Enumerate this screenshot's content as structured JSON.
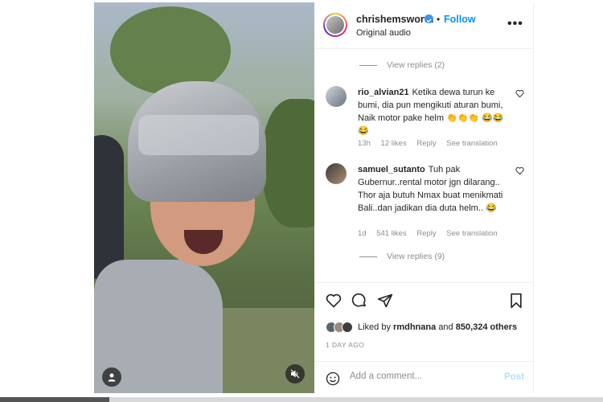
{
  "header": {
    "username": "chrishemsworth",
    "separator": "•",
    "follow_label": "Follow",
    "audio": "Original audio",
    "more_label": "•••"
  },
  "comments": {
    "view_replies_top": "View replies (2)",
    "items": [
      {
        "user": "rio_alvian21",
        "text": "Ketika dewa turun ke bumi, dia pun mengikuti aturan bumi, Naik motor pake helm 👏👏👏 😂😂😂",
        "time": "13h",
        "likes": "12 likes",
        "reply": "Reply",
        "translate": "See translation"
      },
      {
        "user": "samuel_sutanto",
        "text": "Tuh pak Gubernur..rental motor jgn dilarang.. Thor aja butuh Nmax buat menikmati Bali..dan jadikan dia duta helm.. 😂",
        "time": "1d",
        "likes": "541 likes",
        "reply": "Reply",
        "translate": "See translation"
      }
    ],
    "view_replies_bottom": "View replies (9)"
  },
  "actions": {
    "liked_by_prefix": "Liked by",
    "liked_by_user": "rmdhnana",
    "and_text": "and",
    "likes_count": "850,324 others",
    "time_ago": "1 DAY AGO"
  },
  "add_comment": {
    "placeholder": "Add a comment...",
    "post_label": "Post"
  },
  "icons": {
    "verified": "verified-badge-icon",
    "like": "heart-icon",
    "comment": "comment-icon",
    "share": "share-icon",
    "save": "bookmark-icon",
    "emoji": "smiley-icon",
    "tag": "user-tag-icon",
    "mute": "muted-speaker-icon"
  },
  "colors": {
    "accent": "#0095f6",
    "verified": "#3897f0",
    "secondary_text": "#8e8e8e"
  }
}
